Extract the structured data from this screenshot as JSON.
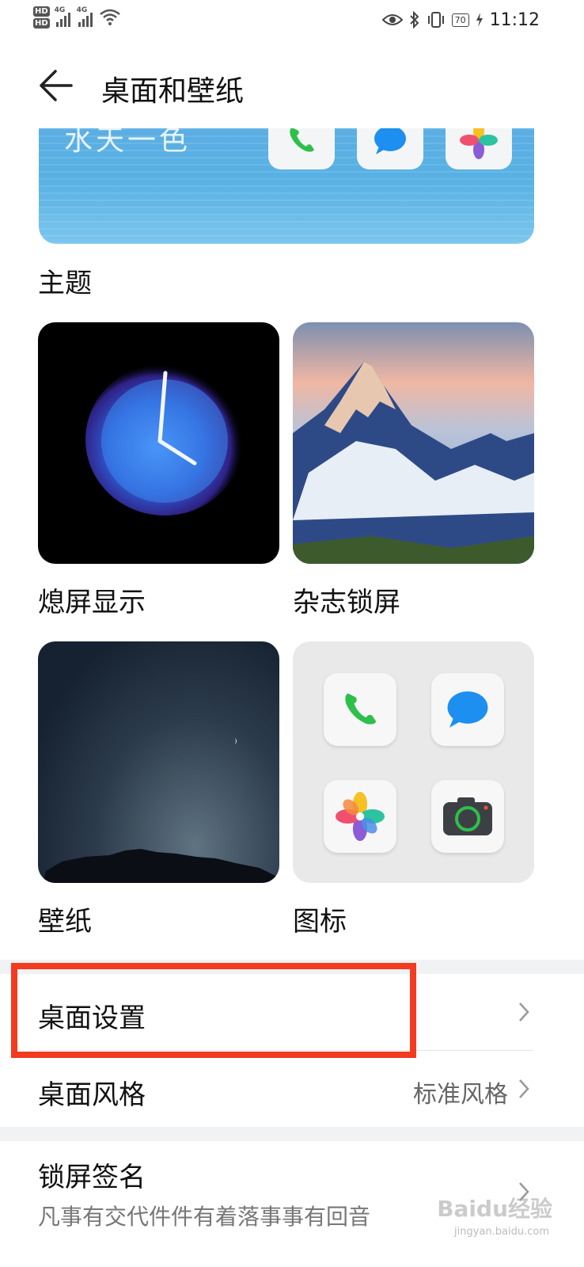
{
  "status_bar": {
    "hd1": "HD",
    "hd2": "HD",
    "net1": "4G",
    "net2": "4G",
    "battery": "70",
    "time": "11:12"
  },
  "header": {
    "title": "桌面和壁纸"
  },
  "theme_banner": {
    "text": "水天一色"
  },
  "sections": {
    "theme_label": "主题",
    "aod_label": "熄屏显示",
    "magazine_label": "杂志锁屏",
    "wallpaper_label": "壁纸",
    "icons_label": "图标"
  },
  "list": {
    "desktop_settings": "桌面设置",
    "desktop_style": "桌面风格",
    "desktop_style_value": "标准风格",
    "lockscreen_signature": "锁屏签名",
    "lockscreen_signature_value": "凡事有交代件件有着落事事有回音"
  },
  "watermark": {
    "brand": "Baidu经验",
    "url": "jingyan.baidu.com"
  },
  "colors": {
    "highlight": "#f23b1f",
    "banner_blue": "#58b1e3"
  }
}
